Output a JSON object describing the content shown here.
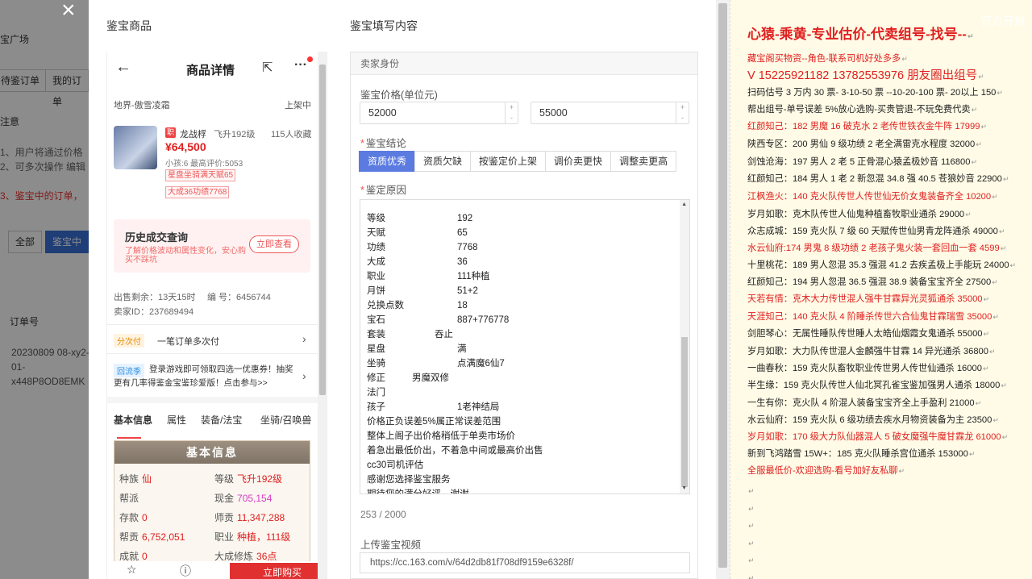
{
  "bg": {
    "lines": [
      "宝广场",
      "注意",
      "1、用户将通过价格",
      "2、可多次操作 编辑",
      "3、鉴宝中的订单，",
      "订单号",
      "20230809 08-xy2-",
      "01-",
      "x448P8OD8EMK"
    ],
    "btns": [
      "待鉴订单",
      "我的订单",
      "全部",
      "鉴宝中"
    ]
  },
  "modal": {
    "left_title": "鉴宝商品",
    "right_title": "鉴宝填写内容"
  },
  "phone": {
    "title": "商品详情",
    "server": "地界-傲雪凌霜",
    "status": "上架中",
    "role_badge": "职",
    "role_name": "龙战桴",
    "role_level": "飞升192级",
    "role_fav": "115人收藏",
    "price": "¥64,500",
    "sub": "小孩:6 最高评价:5053",
    "tags": [
      "星盘坐骑满天赋65",
      "大成36功绩7768"
    ],
    "history_title": "历史成交查询",
    "history_sub": "了解价格波动和属性变化，安心购买不踩坑",
    "history_btn": "立即查看",
    "remain": "出售剩余：13天15时",
    "code": "编 号：6456744",
    "seller": "卖家ID：237689494",
    "pay_tag": "分次付",
    "pay_text": "一笔订单多次付",
    "promo_tag": "回流季",
    "promo_text": "登录游戏即可领取四选一优惠券！抽奖更有几率得鉴金宝鉴珍爱版！点击参与>>",
    "tabs": [
      "基本信息",
      "属性",
      "装备/法宝",
      "坐骑/召唤兽"
    ],
    "basic_title": "基本信息",
    "basic": [
      {
        "k": "种族",
        "v": "仙",
        "c": "red"
      },
      {
        "k": "等级",
        "v": "飞升192级",
        "c": "red"
      },
      {
        "k": "帮派",
        "v": "",
        "c": ""
      },
      {
        "k": "现金",
        "v": "705,154",
        "c": "pink"
      },
      {
        "k": "存款",
        "v": "0",
        "c": "red"
      },
      {
        "k": "师贡",
        "v": "11,347,288",
        "c": "red"
      },
      {
        "k": "帮贡",
        "v": "6,752,051",
        "c": "red"
      },
      {
        "k": "职业",
        "v": "种植，111级",
        "c": "red"
      },
      {
        "k": "成就",
        "v": "0",
        "c": "red"
      },
      {
        "k": "大成修炼",
        "v": "36点",
        "c": "red"
      }
    ],
    "footer_btn": "立即购买"
  },
  "form": {
    "section": "卖家身份",
    "price_label": "鉴宝价格(单位元)",
    "price_min": "52000",
    "price_max": "55000",
    "conclusion_label": "鉴宝结论",
    "conclusions": [
      "资质优秀",
      "资质欠缺",
      "按鉴定价上架",
      "调价卖更快",
      "调整卖更高"
    ],
    "reason_label": "鉴定原因",
    "reason_rows": [
      [
        "等级",
        "192"
      ],
      [
        "天赋",
        "65"
      ],
      [
        "功绩",
        "7768"
      ],
      [
        "大成",
        "36"
      ],
      [
        "职业",
        "111种植"
      ],
      [
        "月饼",
        "51+2"
      ],
      [
        "兑换点数",
        "18"
      ],
      [
        "宝石",
        "887+776778"
      ],
      [
        "套装",
        "吞止"
      ],
      [
        "星盘",
        "满"
      ],
      [
        "坐骑",
        "点满魔6仙7"
      ],
      [
        "修正",
        "男魔双修"
      ],
      [
        "法门",
        ""
      ],
      [
        "孩子",
        "1老神结局"
      ]
    ],
    "reason_text": [
      "价格正负误差5%属正常误差范围",
      "整体上阁子出价格稍低于单卖市场价",
      "着急出最低价出，不着急中间或最高价出售",
      "cc30司机评估",
      "感谢您选择鉴宝服务",
      "期待您的满分好评，谢谢"
    ],
    "char_count": "253 / 2000",
    "video_label": "上传鉴宝视频",
    "video_url": "https://cc.163.com/v/64d2db81f708df9159e6328f/"
  },
  "notes": {
    "watermark": "官方开放",
    "lines": [
      {
        "t": "心猿-乘黄-专业估价-代卖组号-找号--",
        "c": "red big"
      },
      {
        "t": "藏宝阁买物资--角色-联系司机好处多多",
        "c": "red"
      },
      {
        "t": "V 15225921182   13782553976 朋友圈出组号",
        "c": "red mid"
      },
      {
        "t": "扫码估号 3 万内 30 票- 3-10-50 票  --10-20-100 票- 20以上 150",
        "c": ""
      },
      {
        "t": "帮出组号-单号误差 5%放心选购-买贵管退-不玩免费代卖",
        "c": ""
      },
      {
        "t": "红颜知己：182 男魔 16 破克水 2 老传世铁衣金牛阵 17999",
        "c": "red"
      },
      {
        "t": "陕西专区：200 男仙 9 级功绩 2 老全满雷克水程度 32000",
        "c": ""
      },
      {
        "t": "剑蚀沧海：197 男人 2 老 5 正骨混心猿孟极妙音 116800",
        "c": ""
      },
      {
        "t": "红颜知己：184 男人 1 老 2 新忽混 34.8 强 40.5 苍狼妙音 22900",
        "c": ""
      },
      {
        "t": "江枫渔火：140 克火队传世人传世仙无价女鬼装备齐全 10200",
        "c": "red"
      },
      {
        "t": "岁月如歌：克木队传世人仙鬼种植畜牧职业通杀 29000",
        "c": ""
      },
      {
        "t": "众志成城：159 克火队 7 级 60 天赋传世仙男青龙阵通杀 49000",
        "c": ""
      },
      {
        "t": "水云仙府:174 男鬼 8 级功绩 2 老孩子鬼火装一套回血一套 4599",
        "c": "red"
      },
      {
        "t": "十里桃花：189 男人忽混 35.3 强混 41.2 去疾孟极上手能玩 24000",
        "c": ""
      },
      {
        "t": "红颜知己：194 男人忽混 36.5 强混 38.9 装备宝宝齐全 27500",
        "c": ""
      },
      {
        "t": "天若有情：克木大力传世混人强牛甘霖异光灵狐通杀 35000",
        "c": "red"
      },
      {
        "t": "天涯知己：140 克火队 4 阶睡杀传世六合仙鬼甘霖瑞雪 35000",
        "c": "red"
      },
      {
        "t": "剑胆琴心：无属性睡队传世睡人太皓仙烟霞女鬼通杀 55000",
        "c": ""
      },
      {
        "t": "岁月如歌：大力队传世混人金麟强牛甘霖 14 异光通杀 36800",
        "c": ""
      },
      {
        "t": "一曲春秋：159 克火队畜牧职业传世男人传世仙通杀 16000",
        "c": ""
      },
      {
        "t": "半生缘：159 克火队传世人仙北冥孔雀宝鉴加强男人通杀 18000",
        "c": ""
      },
      {
        "t": "一生有你：克火队 4 阶混人装备宝宝齐全上手盈利 21000",
        "c": ""
      },
      {
        "t": "水云仙府：159 克火队 6 级功绩去疾水月物资装备为主 23500",
        "c": ""
      },
      {
        "t": "岁月如歌：170 级大力队仙器混人 5 破女魔强牛魔甘霖龙 61000",
        "c": "red"
      },
      {
        "t": "新到飞鸿踏雪 15W+：185 克火队睡杀宫位通杀 153000",
        "c": ""
      },
      {
        "t": "全服最低价-欢迎选购-看号加好友私聊",
        "c": "red"
      }
    ]
  }
}
